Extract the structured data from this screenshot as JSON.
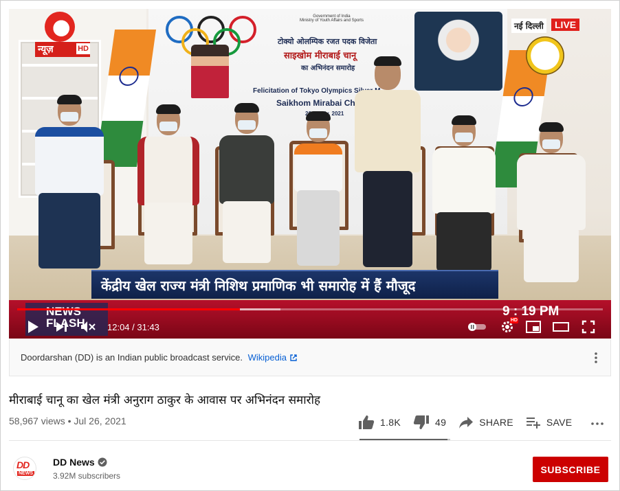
{
  "player": {
    "brand_label": "न्यूज़",
    "brand_hd": "HD",
    "location": "नई दिल्ली",
    "live_badge": "LIVE",
    "backdrop": {
      "govt_line1": "Government of India",
      "govt_line2": "Ministry of Youth Affairs and Sports",
      "hindi_line1": "टोक्यो ओलम्पिक रजत पदक विजेता",
      "hindi_line2": "साइखोम मीराबाई चानू",
      "hindi_line3": "का अभिनंदन समारोह",
      "english_line1": "Felicitation of Tokyo Olympics Silver M",
      "english_line2": "Saikhom Mirabai Ch",
      "date": "26th July, 2021"
    },
    "ticker": "केंद्रीय खेल राज्य मंत्री निशिथ प्रमाणिक भी समारोह में हैं मौजूद",
    "news_flash": "NEWS FLASH",
    "clock": "9 : 19 PM",
    "time_display": "12:04 / 31:43",
    "progress_fraction": 0.38,
    "buffer_fraction": 0.45,
    "settings_badge": "HD",
    "icons": {
      "play": "play-icon",
      "next": "next-icon",
      "mute": "volume-muted-icon",
      "autoplay": "autoplay-toggle-icon",
      "settings": "gear-icon",
      "miniplayer": "miniplayer-icon",
      "theater": "theater-mode-icon",
      "fullscreen": "fullscreen-icon"
    }
  },
  "info_panel": {
    "text": "Doordarshan (DD) is an Indian public broadcast service.",
    "link_text": "Wikipedia"
  },
  "video": {
    "title": "मीराबाई चानू का खेल मंत्री अनुराग ठाकुर के आवास पर अभिनंदन समारोह",
    "meta": "58,967 views • Jul 26, 2021",
    "likes": "1.8K",
    "dislikes": "49",
    "share_label": "SHARE",
    "save_label": "SAVE",
    "like_ratio": 0.97
  },
  "channel": {
    "avatar_top": "DD",
    "avatar_bottom": "NEWS",
    "name": "DD News",
    "subscribers": "3.92M subscribers",
    "subscribe_label": "SUBSCRIBE"
  },
  "colors": {
    "youtube_red": "#cc0000",
    "progress_red": "#ff0000",
    "link_blue": "#065fd4",
    "ticker_navy": "#0f2149",
    "dd_red": "#e2261f"
  }
}
